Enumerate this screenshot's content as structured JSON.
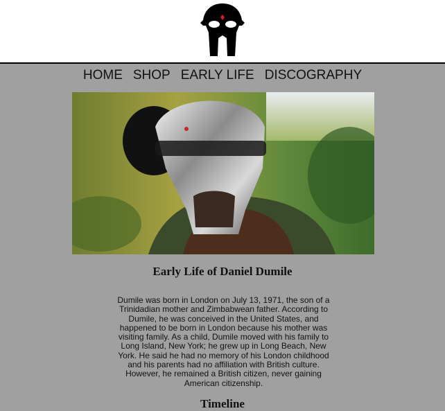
{
  "nav": {
    "items": [
      "HOME",
      "SHOP",
      "EARLY LIFE",
      "DISCOGRAPHY"
    ]
  },
  "main": {
    "title": "Early Life of Daniel Dumile",
    "paragraph": "Dumile was born in London on July 13, 1971, the son of a Trinidadian mother and Zimbabwean father. According to Dumile, he was conceived in the United States, and happened to be born in London because his mother was visiting family. As a child, Dumile moved with his family to Long Island, New York; he grew up in Long Beach, New York. He said he had no memory of his London childhood and his parents had no affiliation with British culture. However, he remained a British citizen, never gaining American citizenship.",
    "next_heading": "Timeline"
  },
  "icons": {
    "logo": "metal-mask-logo"
  }
}
